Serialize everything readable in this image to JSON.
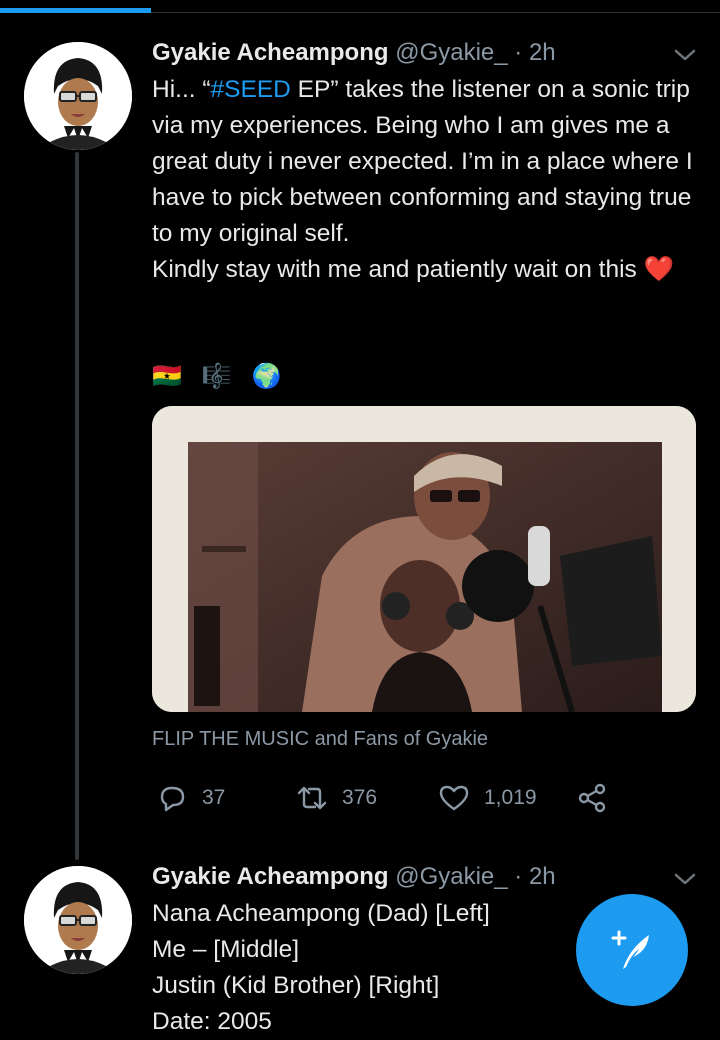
{
  "progress": {
    "fraction": 0.21,
    "color": "#1d9bf0"
  },
  "tweets": [
    {
      "author_name": "Gyakie Acheampong",
      "handle": "@Gyakie_",
      "separator": "·",
      "time": "2h",
      "text_before": "Hi... “",
      "hashtag": "#SEED",
      "text_after": " EP” takes the listener on a sonic trip via my experiences. Being who I am gives me a great duty i never expected. I’m in a place where I have to pick between conforming and staying true to my original self.\nKindly stay with me and patiently wait on this ❤️",
      "emojis": [
        "🇬🇭",
        "🎼",
        "🌍"
      ],
      "tagged": "FLIP THE MUSIC and Fans of Gyakie",
      "actions": {
        "replies": "37",
        "retweets": "376",
        "likes": "1,019"
      }
    },
    {
      "author_name": "Gyakie Acheampong",
      "handle": "@Gyakie_",
      "separator": "·",
      "time": "2h",
      "text": "Nana Acheampong (Dad) [Left]\nMe – [Middle]\nJustin (Kid Brother) [Right]\nDate: 2005"
    }
  ],
  "icons": {
    "reply": "reply-icon",
    "retweet": "retweet-icon",
    "like": "like-icon",
    "share": "share-icon",
    "compose": "compose-tweet-icon",
    "menu": "chevron-down-icon"
  },
  "colors": {
    "background": "#000000",
    "accent": "#1d9bf0",
    "secondary_text": "#8b98a5"
  }
}
